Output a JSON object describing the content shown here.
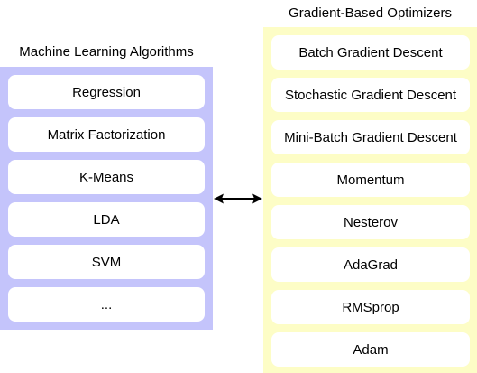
{
  "left_group": {
    "title": "Machine Learning Algorithms",
    "items": [
      {
        "label": "Regression"
      },
      {
        "label": "Matrix Factorization"
      },
      {
        "label": "K-Means"
      },
      {
        "label": "LDA"
      },
      {
        "label": "SVM"
      },
      {
        "label": "..."
      }
    ],
    "color": "#c4c4fb"
  },
  "right_group": {
    "title": "Gradient-Based Optimizers",
    "items": [
      {
        "label": "Batch Gradient Descent"
      },
      {
        "label": "Stochastic Gradient Descent"
      },
      {
        "label": "Mini-Batch Gradient Descent"
      },
      {
        "label": "Momentum"
      },
      {
        "label": "Nesterov"
      },
      {
        "label": "AdaGrad"
      },
      {
        "label": "RMSprop"
      },
      {
        "label": "Adam"
      }
    ],
    "color": "#fdfdc6"
  },
  "connector": {
    "type": "bidirectional-arrow-icon",
    "color": "#000000"
  }
}
